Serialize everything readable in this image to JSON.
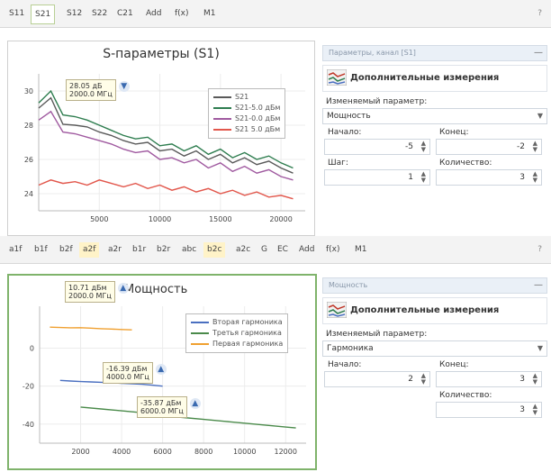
{
  "panel1": {
    "tabs": [
      "S11",
      "S21",
      "S12",
      "S22",
      "C21",
      "Add",
      "f(x)",
      "M1"
    ],
    "active_tab": 1,
    "help_icon": "?",
    "chart_title": "S-параметры (S1)",
    "marker": {
      "line1": "28.05 дБ",
      "line2": "2000.0 МГц"
    },
    "legend": [
      {
        "label": "S21",
        "color": "#5a5a5a"
      },
      {
        "label": "S21-5.0 дБм",
        "color": "#2e7d4f"
      },
      {
        "label": "S21-0.0 дБм",
        "color": "#a05aa0"
      },
      {
        "label": "S21 5.0 дБм",
        "color": "#e2574c"
      }
    ],
    "side": {
      "header": "Параметры, канал [S1]",
      "title": "Дополнительные измерения",
      "param_label": "Изменяемый параметр:",
      "param_value": "Мощность",
      "start_label": "Начало:",
      "start_value": "-5",
      "end_label": "Конец:",
      "end_value": "-2",
      "step_label": "Шаг:",
      "step_value": "1",
      "count_label": "Количество:",
      "count_value": "3"
    }
  },
  "panel2": {
    "tabs": [
      "a1f",
      "b1f",
      "b2f",
      "a2f",
      "a2r",
      "b1r",
      "b2r",
      "abc",
      "b2c",
      "a2c",
      "G",
      "EC",
      "Add",
      "f(x)",
      "M1"
    ],
    "highlighted_tabs": [
      3,
      8
    ],
    "help_icon": "?",
    "chart_title": "Мощность",
    "markers": [
      {
        "line1": "10.71 дБм",
        "line2": "2000.0 МГц"
      },
      {
        "line1": "-16.39 дБм",
        "line2": "4000.0 МГц"
      },
      {
        "line1": "-35.87 дБм",
        "line2": "6000.0 МГц"
      }
    ],
    "legend": [
      {
        "label": "Вторая гармоника",
        "color": "#4a6fc0"
      },
      {
        "label": "Третья гармоника",
        "color": "#4a8a4a"
      },
      {
        "label": "Первая гармоника",
        "color": "#f0a030"
      }
    ],
    "side": {
      "header": "Мощность",
      "title": "Дополнительные измерения",
      "param_label": "Изменяемый параметр:",
      "param_value": "Гармоника",
      "start_label": "Начало:",
      "start_value": "2",
      "end_label": "Конец:",
      "end_value": "3",
      "count_label": "Количество:",
      "count_value": "3"
    }
  },
  "chart_data": [
    {
      "type": "line",
      "title": "S-параметры (S1)",
      "x_ticks": [
        "5000",
        "10000",
        "15000",
        "20000"
      ],
      "y_ticks": [
        "30",
        "28",
        "26",
        "24"
      ],
      "xlim": [
        0,
        22000
      ],
      "ylim": [
        23,
        31
      ],
      "series": [
        {
          "name": "S21",
          "x": [
            0,
            1000,
            2000,
            3000,
            4000,
            5000,
            6000,
            7000,
            8000,
            9000,
            10000,
            11000,
            12000,
            13000,
            14000,
            15000,
            16000,
            17000,
            18000,
            19000,
            20000,
            21000
          ],
          "values": [
            29.0,
            29.6,
            28.05,
            28.0,
            27.9,
            27.6,
            27.4,
            27.1,
            26.9,
            27.0,
            26.5,
            26.6,
            26.2,
            26.5,
            26.0,
            26.3,
            25.8,
            26.1,
            25.7,
            25.9,
            25.5,
            25.2
          ]
        },
        {
          "name": "S21-5.0 дБм",
          "x": [
            0,
            1000,
            2000,
            3000,
            4000,
            5000,
            6000,
            7000,
            8000,
            9000,
            10000,
            11000,
            12000,
            13000,
            14000,
            15000,
            16000,
            17000,
            18000,
            19000,
            20000,
            21000
          ],
          "values": [
            29.3,
            30.0,
            28.6,
            28.5,
            28.3,
            28.0,
            27.7,
            27.4,
            27.2,
            27.3,
            26.8,
            26.9,
            26.5,
            26.8,
            26.3,
            26.6,
            26.1,
            26.4,
            26.0,
            26.2,
            25.8,
            25.5
          ]
        },
        {
          "name": "S21-0.0 дБм",
          "x": [
            0,
            1000,
            2000,
            3000,
            4000,
            5000,
            6000,
            7000,
            8000,
            9000,
            10000,
            11000,
            12000,
            13000,
            14000,
            15000,
            16000,
            17000,
            18000,
            19000,
            20000,
            21000
          ],
          "values": [
            28.3,
            28.8,
            27.6,
            27.5,
            27.3,
            27.1,
            26.9,
            26.6,
            26.4,
            26.5,
            26.0,
            26.1,
            25.8,
            26.0,
            25.5,
            25.8,
            25.3,
            25.6,
            25.2,
            25.4,
            25.0,
            24.8
          ]
        },
        {
          "name": "S21 5.0 дБм",
          "x": [
            0,
            1000,
            2000,
            3000,
            4000,
            5000,
            6000,
            7000,
            8000,
            9000,
            10000,
            11000,
            12000,
            13000,
            14000,
            15000,
            16000,
            17000,
            18000,
            19000,
            20000,
            21000
          ],
          "values": [
            24.5,
            24.8,
            24.6,
            24.7,
            24.5,
            24.8,
            24.6,
            24.4,
            24.6,
            24.3,
            24.5,
            24.2,
            24.4,
            24.1,
            24.3,
            24.0,
            24.2,
            23.9,
            24.1,
            23.8,
            23.9,
            23.7
          ]
        }
      ]
    },
    {
      "type": "line",
      "title": "Мощность",
      "x_ticks": [
        "2000",
        "4000",
        "6000",
        "8000",
        "10000",
        "12000"
      ],
      "y_ticks": [
        "0",
        "-20",
        "-40"
      ],
      "xlim": [
        0,
        13000
      ],
      "ylim": [
        -50,
        22
      ],
      "series": [
        {
          "name": "Вторая гармоника",
          "x": [
            1000,
            1500,
            2000,
            2500,
            3000,
            3500,
            4000,
            4500,
            5000,
            5500,
            6000
          ],
          "values": [
            -17,
            -17.3,
            -17.6,
            -17.8,
            -18,
            -18.2,
            -18.5,
            -18.8,
            -19,
            -19.5,
            -20
          ]
        },
        {
          "name": "Третья гармоника",
          "x": [
            2000,
            3000,
            4000,
            5000,
            6000,
            7000,
            8000,
            9000,
            10000,
            11000,
            12000,
            12500
          ],
          "values": [
            -31,
            -32,
            -33,
            -34,
            -35.5,
            -36.5,
            -37.5,
            -38.5,
            -39.5,
            -40.5,
            -41.5,
            -42
          ]
        },
        {
          "name": "Первая гармоника",
          "x": [
            500,
            1000,
            1500,
            2000,
            2500,
            3000,
            3500,
            4000,
            4500
          ],
          "values": [
            11,
            10.8,
            10.7,
            10.71,
            10.5,
            10.2,
            10,
            9.8,
            9.6
          ]
        }
      ]
    }
  ]
}
